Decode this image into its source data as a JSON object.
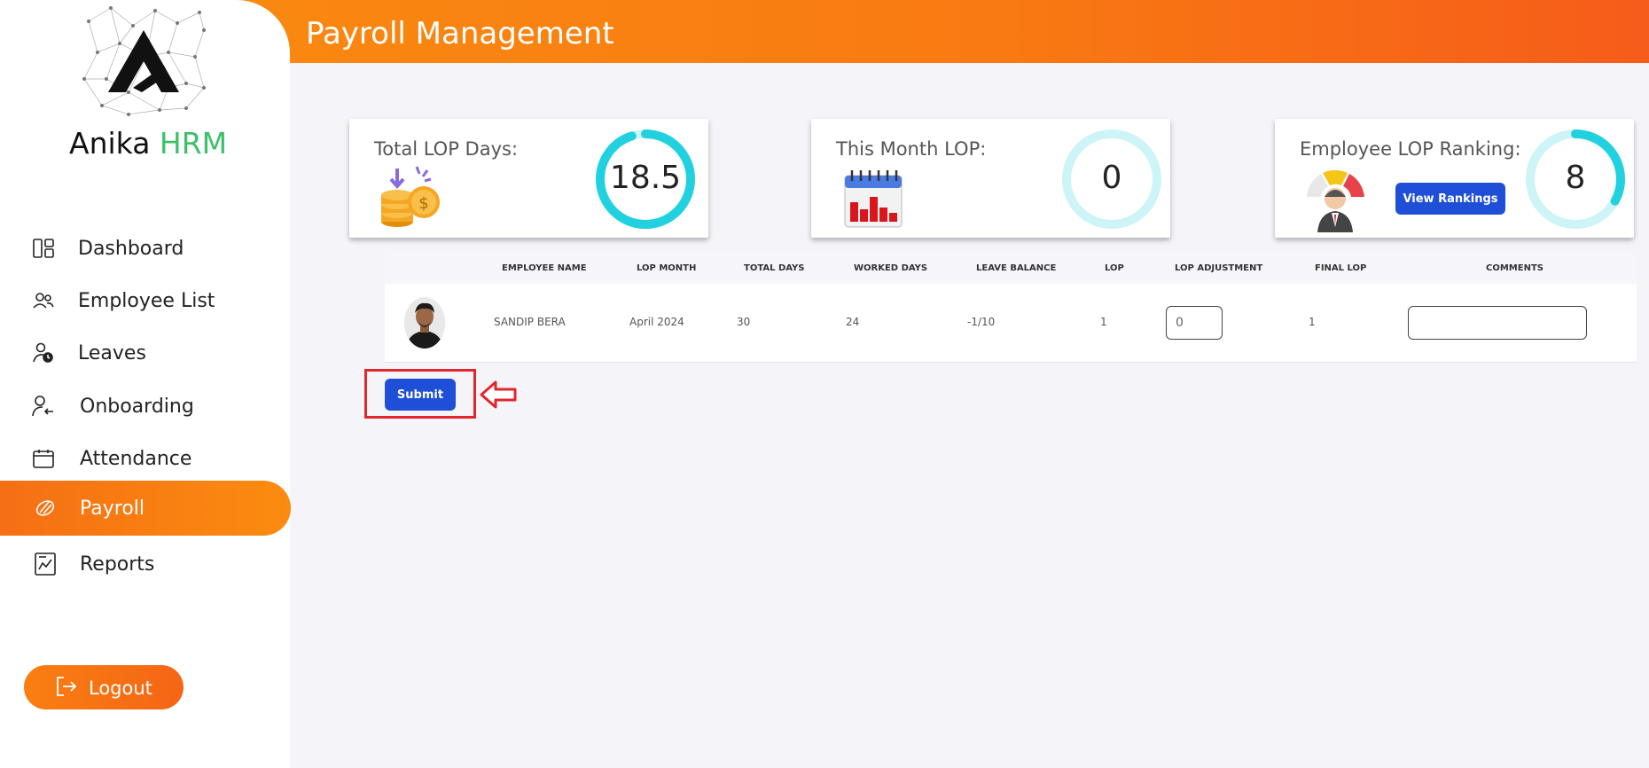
{
  "header": {
    "title": "Payroll Management"
  },
  "brand": {
    "name_part1": "Anika",
    "name_part2": "HRM"
  },
  "sidebar": {
    "items": [
      {
        "label": "Dashboard",
        "icon": "dashboard-icon"
      },
      {
        "label": "Employee List",
        "icon": "users-icon"
      },
      {
        "label": "Leaves",
        "icon": "user-clock-icon"
      },
      {
        "label": "Onboarding",
        "icon": "user-arrow-icon"
      },
      {
        "label": "Attendance",
        "icon": "calendar-icon"
      },
      {
        "label": "Payroll",
        "icon": "payroll-icon",
        "active": true
      },
      {
        "label": "Reports",
        "icon": "report-chart-icon"
      }
    ],
    "logout_label": "Logout"
  },
  "cards": {
    "total_lop": {
      "title": "Total LOP Days:",
      "value": "18.5",
      "ring_fraction": 0.95
    },
    "month_lop": {
      "title": "This Month LOP:",
      "value": "0",
      "ring_fraction": 0.0
    },
    "ranking": {
      "title": "Employee LOP Ranking:",
      "value": "8",
      "button_label": "View Rankings",
      "ring_fraction": 0.33
    }
  },
  "table": {
    "headers": [
      "EMPLOYEE NAME",
      "LOP MONTH",
      "TOTAL DAYS",
      "WORKED DAYS",
      "LEAVE BALANCE",
      "LOP",
      "LOP ADJUSTMENT",
      "FINAL LOP",
      "COMMENTS"
    ],
    "rows": [
      {
        "employee_name": "SANDIP BERA",
        "lop_month": "April 2024",
        "total_days": "30",
        "worked_days": "24",
        "leave_balance": "-1/10",
        "lop": "1",
        "lop_adjustment": "0",
        "final_lop": "1",
        "comments": ""
      }
    ]
  },
  "actions": {
    "submit_label": "Submit"
  },
  "colors": {
    "accent_orange": "#f98d10",
    "primary_blue": "#1f4fd6",
    "ring_cyan": "#22d1e0",
    "highlight_red": "#e1262c",
    "brand_green": "#3cc068"
  }
}
